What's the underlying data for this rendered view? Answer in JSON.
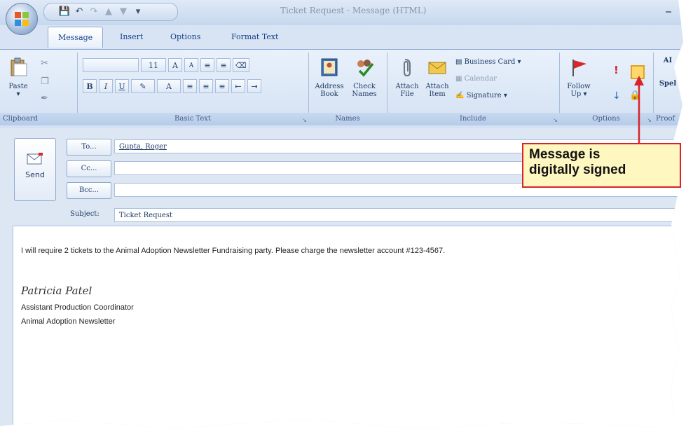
{
  "window": {
    "title": "Ticket Request - Message (HTML)"
  },
  "tabs": [
    {
      "label": "Message",
      "active": true
    },
    {
      "label": "Insert"
    },
    {
      "label": "Options"
    },
    {
      "label": "Format Text"
    }
  ],
  "ribbon": {
    "clipboard": {
      "label": "Clipboard",
      "paste": "Paste"
    },
    "basic_text": {
      "label": "Basic Text",
      "font_size": "11",
      "bold": "B",
      "italic": "I",
      "underline": "U",
      "grow": "A",
      "shrink": "A"
    },
    "names": {
      "label": "Names",
      "address_book_1": "Address",
      "address_book_2": "Book",
      "check_names_1": "Check",
      "check_names_2": "Names"
    },
    "include": {
      "label": "Include",
      "attach_file_1": "Attach",
      "attach_file_2": "File",
      "attach_item_1": "Attach",
      "attach_item_2": "Item",
      "business_card": "Business Card",
      "calendar": "Calendar",
      "signature": "Signature"
    },
    "options": {
      "label": "Options",
      "follow_up_1": "Follow",
      "follow_up_2": "Up"
    },
    "proofing": {
      "label": "Proof",
      "spell": "Spel",
      "abc": "AI"
    }
  },
  "compose": {
    "send_label": "Send",
    "to_label": "To...",
    "cc_label": "Cc...",
    "bcc_label": "Bcc...",
    "subject_label": "Subject:",
    "to_value": "Gupta, Roger",
    "cc_value": "",
    "bcc_value": "",
    "subject_value": "Ticket Request"
  },
  "body": {
    "line1": "I will require 2 tickets to the Animal Adoption Newsletter Fundraising party. Please charge the newsletter account #123-4567.",
    "signature_name": "Patricia Patel",
    "signature_title": "Assistant Production Coordinator",
    "signature_org": "Animal Adoption Newsletter"
  },
  "callout": {
    "line1": "Message is",
    "line2": "digitally signed"
  },
  "colors": {
    "accent": "#d9232a",
    "callout_bg": "#fff7c0",
    "ribbon": "#d3e1f3"
  }
}
